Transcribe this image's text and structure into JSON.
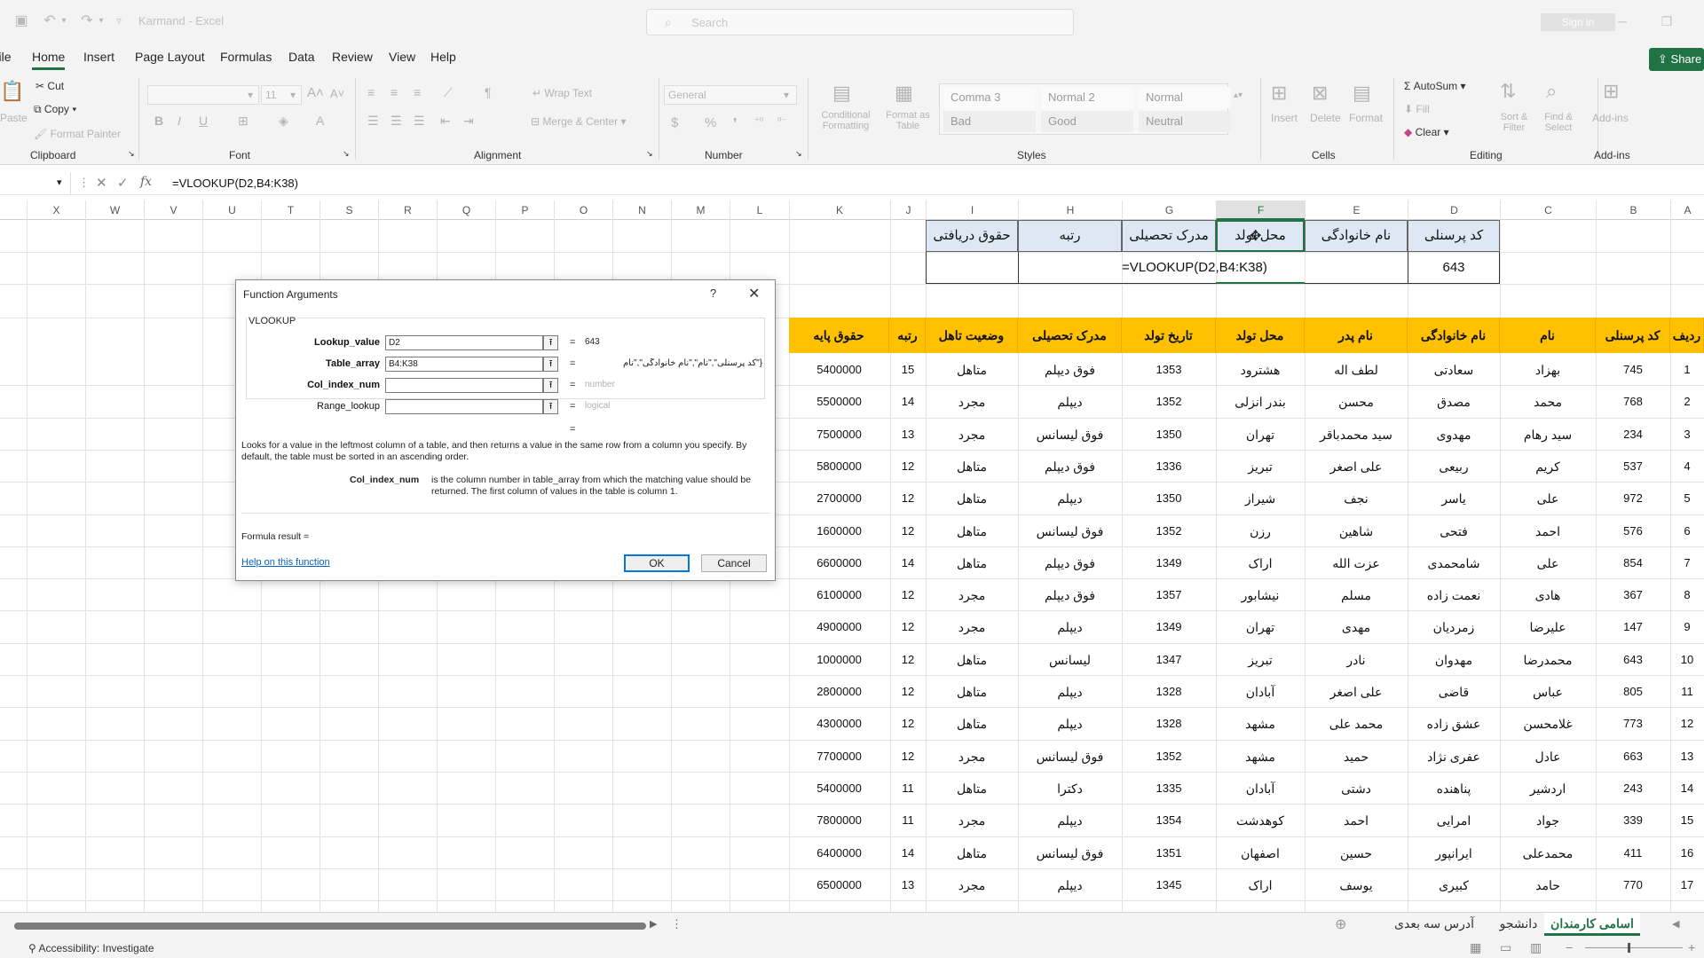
{
  "window": {
    "title": "Karmand - Excel",
    "search_placeholder": "Search",
    "signin": "Sign in"
  },
  "menu": {
    "file": "File",
    "tabs": [
      "Home",
      "Insert",
      "Page Layout",
      "Formulas",
      "Data",
      "Review",
      "View",
      "Help"
    ],
    "share": "Share"
  },
  "ribbon": {
    "clipboard": {
      "paste": "Paste",
      "cut": "Cut",
      "copy": "Copy",
      "format_painter": "Format Painter",
      "label": "Clipboard"
    },
    "font": {
      "font_name": "",
      "font_size": "11",
      "label": "Font"
    },
    "alignment": {
      "wrap_text": "Wrap Text",
      "merge_center": "Merge & Center",
      "label": "Alignment"
    },
    "number": {
      "format": "General",
      "label": "Number"
    },
    "styles": {
      "conditional_formatting": "Conditional Formatting",
      "format_as_table": "Format as Table",
      "cells": [
        "Comma 3",
        "Normal 2",
        "Normal",
        "Bad",
        "Good",
        "Neutral"
      ],
      "label": "Styles"
    },
    "cells": {
      "insert": "Insert",
      "delete": "Delete",
      "format": "Format",
      "label": "Cells"
    },
    "editing": {
      "autosum": "AutoSum",
      "fill": "Fill",
      "clear": "Clear",
      "sort_filter": "Sort & Filter",
      "find_select": "Find & Select",
      "label": "Editing"
    },
    "addins": {
      "addins": "Add-ins",
      "label": "Add-ins"
    }
  },
  "formula_bar": {
    "fx": "fx",
    "formula": "=VLOOKUP(D2,B4:K38)"
  },
  "columns": [
    "X",
    "W",
    "V",
    "U",
    "T",
    "S",
    "R",
    "Q",
    "P",
    "O",
    "N",
    "M",
    "L",
    "K",
    "J",
    "I",
    "H",
    "G",
    "F",
    "E",
    "D",
    "C",
    "B",
    "A"
  ],
  "lookup_table": {
    "headers": [
      "حقوق دریافتی",
      "رتبه",
      "مدرک تحصیلی",
      "محل تولد",
      "نام خانوادگی",
      "کد پرسنلی"
    ],
    "code_value": "643",
    "formula_display": "=VLOOKUP(D2,B4:K38)"
  },
  "table": {
    "headers": [
      "ردیف",
      "کد پرسنلی",
      "نام",
      "نام خانوادگی",
      "نام پدر",
      "محل تولد",
      "تاریخ تولد",
      "مدرک تحصیلی",
      "وضعیت تاهل",
      "رتبه",
      "حقوق پایه"
    ],
    "rows": [
      [
        "1",
        "745",
        "بهزاد",
        "سعادتی",
        "لطف اله",
        "هشترود",
        "1353",
        "فوق دیپلم",
        "متاهل",
        "15",
        "5400000"
      ],
      [
        "2",
        "768",
        "محمد",
        "مصدق",
        "محسن",
        "بندر انزلی",
        "1352",
        "دیپلم",
        "مجرد",
        "14",
        "5500000"
      ],
      [
        "3",
        "234",
        "سید رهام",
        "مهدوی",
        "سید محمدباقر",
        "تهران",
        "1350",
        "فوق لیسانس",
        "مجرد",
        "13",
        "7500000"
      ],
      [
        "4",
        "537",
        "کریم",
        "ربیعی",
        "علی اصغر",
        "تبریز",
        "1336",
        "فوق دیپلم",
        "متاهل",
        "12",
        "5800000"
      ],
      [
        "5",
        "972",
        "علی",
        "یاسر",
        "نجف",
        "شیراز",
        "1350",
        "دیپلم",
        "متاهل",
        "12",
        "2700000"
      ],
      [
        "6",
        "576",
        "احمد",
        "فتحی",
        "شاهین",
        "رزن",
        "1352",
        "فوق لیسانس",
        "متاهل",
        "12",
        "1600000"
      ],
      [
        "7",
        "854",
        "علی",
        "شامحمدی",
        "عزت الله",
        "اراک",
        "1349",
        "فوق دیپلم",
        "متاهل",
        "14",
        "6600000"
      ],
      [
        "8",
        "367",
        "هادی",
        "نعمت زاده",
        "مسلم",
        "نیشابور",
        "1357",
        "فوق دیپلم",
        "مجرد",
        "12",
        "6100000"
      ],
      [
        "9",
        "147",
        "علیرضا",
        "زمردیان",
        "مهدی",
        "تهران",
        "1349",
        "دیپلم",
        "مجرد",
        "12",
        "4900000"
      ],
      [
        "10",
        "643",
        "محمدرضا",
        "مهدوان",
        "نادر",
        "تبریز",
        "1347",
        "لیسانس",
        "متاهل",
        "12",
        "1000000"
      ],
      [
        "11",
        "805",
        "عباس",
        "قاضی",
        "علی اصغر",
        "آبادان",
        "1328",
        "دیپلم",
        "متاهل",
        "12",
        "2800000"
      ],
      [
        "12",
        "773",
        "غلامحسن",
        "عشق زاده",
        "محمد علی",
        "مشهد",
        "1328",
        "دیپلم",
        "متاهل",
        "12",
        "4300000"
      ],
      [
        "13",
        "663",
        "عادل",
        "عفری نژاد",
        "حمید",
        "مشهد",
        "1352",
        "فوق لیسانس",
        "مجرد",
        "12",
        "7700000"
      ],
      [
        "14",
        "243",
        "اردشیر",
        "پناهنده",
        "دشتی",
        "آبادان",
        "1335",
        "دکترا",
        "متاهل",
        "11",
        "5400000"
      ],
      [
        "15",
        "339",
        "جواد",
        "امرایی",
        "احمد",
        "کوهدشت",
        "1354",
        "دیپلم",
        "مجرد",
        "11",
        "7800000"
      ],
      [
        "16",
        "411",
        "محمدعلی",
        "ایرانپور",
        "حسین",
        "اصفهان",
        "1351",
        "فوق لیسانس",
        "متاهل",
        "14",
        "6400000"
      ],
      [
        "17",
        "770",
        "حامد",
        "کبیری",
        "یوسف",
        "اراک",
        "1345",
        "دیپلم",
        "مجرد",
        "13",
        "6500000"
      ]
    ]
  },
  "dialog": {
    "title": "Function Arguments",
    "help_glyph": "?",
    "function_name": "VLOOKUP",
    "args": [
      {
        "label": "Lookup_value",
        "value": "D2",
        "result": "643",
        "placeholder": ""
      },
      {
        "label": "Table_array",
        "value": "B4:K38",
        "result": "{\"کد پرسنلی\",\"نام\",\"نام خانوادگی\",\"نام",
        "placeholder": ""
      },
      {
        "label": "Col_index_num",
        "value": "",
        "result": "number",
        "placeholder": ""
      },
      {
        "label": "Range_lookup",
        "value": "",
        "result": "logical",
        "placeholder": ""
      }
    ],
    "equals": "=",
    "description": "Looks for a value in the leftmost column of a table, and then returns a value in the same row from a column you specify. By default, the table must be sorted in an ascending order.",
    "arg_help_name": "Col_index_num",
    "arg_help_text": "is the column number in table_array from which the matching value should be returned. The first column of values in the table is column 1.",
    "formula_result": "Formula result =",
    "help_link": "Help on this function",
    "ok": "OK",
    "cancel": "Cancel"
  },
  "sheets": [
    "اسامی کارمندان",
    "دانشجو",
    "آدرس سه بعدی"
  ],
  "status": {
    "accessibility": "Accessibility: Investigate"
  },
  "colors": {
    "accent": "#217346",
    "header_yellow": "#ffc000",
    "lookup_header_blue": "#dde8f4"
  }
}
